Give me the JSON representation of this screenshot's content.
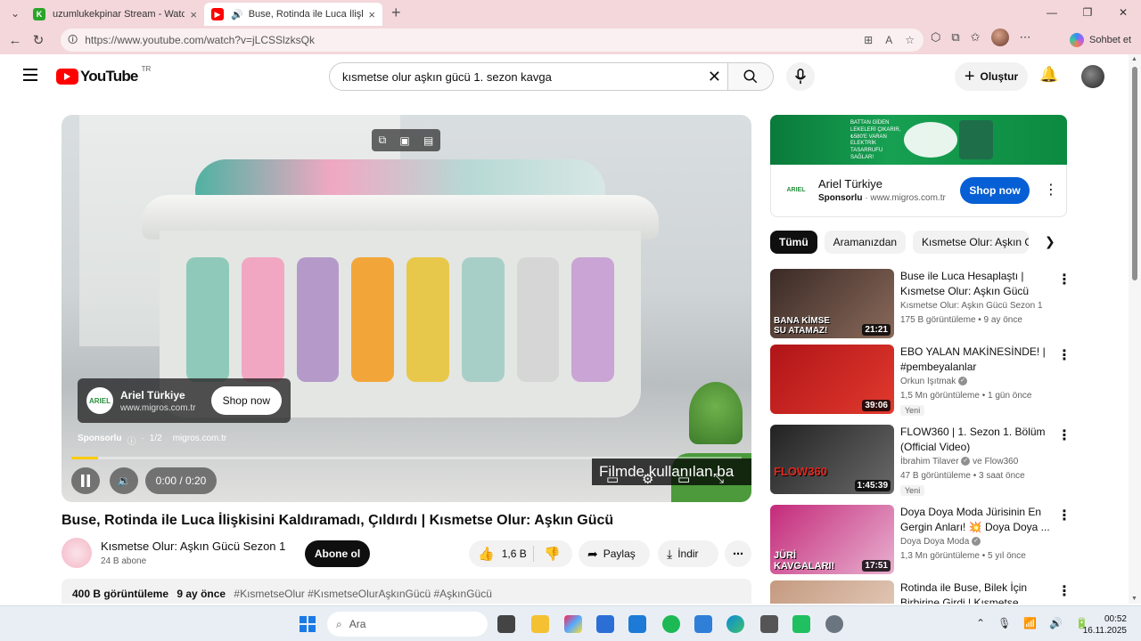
{
  "browser": {
    "tabs": [
      {
        "title": "uzumlukekpinar Stream - Watch l",
        "favicon_color": "#2aa52a",
        "favicon_letter": "K"
      },
      {
        "title": "Buse, Rotinda ile Luca İlişkisi",
        "favicon_color": "#ff0000"
      }
    ],
    "url": "https://www.youtube.com/watch?v=jLCSSlzksQk",
    "copilot_label": "Sohbet et"
  },
  "header": {
    "logo_text": "YouTube",
    "country": "TR",
    "search_value": "kısmetse olur aşkın gücü 1. sezon kavga",
    "create_label": "Oluştur"
  },
  "player": {
    "ad_name": "Ariel Türkiye",
    "ad_domain": "www.migros.com.tr",
    "shop_label": "Shop now",
    "sponsored": "Sponsorlu",
    "ad_count": "1/2",
    "ad_site": "migros.com.tr",
    "time": "0:00 / 0:20",
    "caption": "Filmde kullanılan ba",
    "progress": 0.04
  },
  "video": {
    "title": "Buse, Rotinda ile Luca İlişkisini Kaldıramadı, Çıldırdı | Kısmetse Olur: Aşkın Gücü",
    "channel": "Kısmetse Olur: Aşkın Gücü Sezon 1",
    "subs": "24 B abone",
    "subscribe": "Abone ol",
    "likes": "1,6 B",
    "share": "Paylaş",
    "download": "İndir",
    "views": "400 B görüntüleme",
    "ago": "9 ay önce",
    "tags": "#KısmetseOlur #KısmetseOlurAşkınGücü #AşkınGücü"
  },
  "side_ad": {
    "name": "Ariel Türkiye",
    "sponsored": "Sponsorlu",
    "domain": "www.migros.com.tr",
    "shop": "Shop now",
    "banner_text": "BATTAN GİDEN LEKELERİ ÇIKARIR, ₺580'E VARAN ELEKTRİK TASARRUFU SAĞLAR!"
  },
  "chips": [
    "Tümü",
    "Aramanızdan",
    "Kısmetse Olur: Aşkın Gü"
  ],
  "recommendations": [
    {
      "title": "Buse ile Luca Hesaplaştı | Kısmetse Olur: Aşkın Gücü",
      "channel": "Kısmetse Olur: Aşkın Gücü Sezon 1",
      "meta": "175 B görüntüleme • 9 ay önce",
      "duration": "21:21",
      "overlay": "BANA KİMSE SU ATAMAZ!",
      "badge": "",
      "c1": "#3a2a26",
      "c2": "#8a6a5a"
    },
    {
      "title": "EBO YALAN MAKİNESİNDE! | #pembeyalanlar",
      "channel": "Orkun Işıtmak",
      "meta": "1,5 Mn görüntüleme • 1 gün önce",
      "duration": "39:06",
      "overlay": "",
      "badge": "Yeni",
      "c1": "#b01418",
      "c2": "#e23a2e"
    },
    {
      "title": "FLOW360 | 1. Sezon 1. Bölüm (Official Video)",
      "channel": "İbrahim Tilaver",
      "channel_extra": " ve Flow360",
      "meta": "47 B görüntüleme • 3 saat önce",
      "duration": "1:45:39",
      "overlay": "FLOW360",
      "badge": "Yeni",
      "c1": "#222222",
      "c2": "#6a6a6a"
    },
    {
      "title": "Doya Doya Moda Jürisinin En Gergin Anları! 💥 Doya Doya ...",
      "channel": "Doya Doya Moda",
      "meta": "1,3 Mn görüntüleme • 5 yıl önce",
      "duration": "17:51",
      "overlay": "JÜRİ KAVGALARI!",
      "badge": "",
      "c1": "#c42a7a",
      "c2": "#e8b0d0"
    },
    {
      "title": "Rotinda ile Buse, Bilek İçin Birbirine Girdi | Kısmetse",
      "channel": "",
      "meta": "",
      "duration": "",
      "overlay": "",
      "badge": "",
      "c1": "#c49a80",
      "c2": "#e8d2c2"
    }
  ],
  "taskbar": {
    "search": "Ara",
    "time": "00:52",
    "date": "16.11.2025"
  }
}
